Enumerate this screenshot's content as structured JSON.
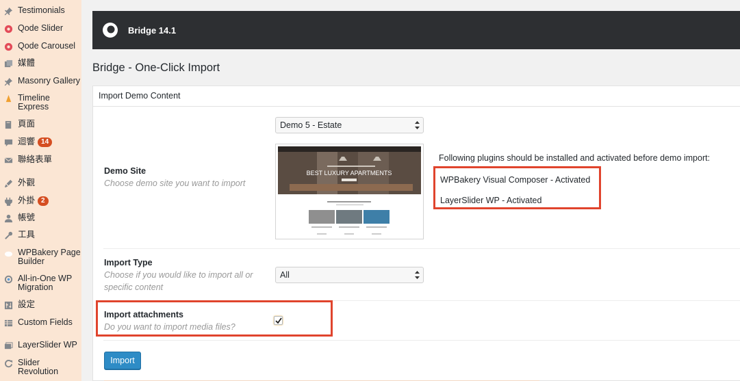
{
  "sidebar": {
    "items": [
      {
        "label": "Testimonials",
        "icon": "pin-icon"
      },
      {
        "label": "Qode Slider",
        "icon": "qode-icon"
      },
      {
        "label": "Qode Carousel",
        "icon": "qode-icon"
      },
      {
        "label": "媒體",
        "icon": "media-icon"
      },
      {
        "label": "Masonry Gallery",
        "icon": "pin-icon"
      },
      {
        "label": "Timeline Express",
        "icon": "timeline-icon"
      },
      {
        "label": "頁面",
        "icon": "pages-icon"
      },
      {
        "label": "迴響",
        "icon": "comments-icon",
        "badge": "14"
      },
      {
        "label": "聯絡表單",
        "icon": "mail-icon"
      },
      {
        "label": "外觀",
        "icon": "appearance-icon"
      },
      {
        "label": "外掛",
        "icon": "plugins-icon",
        "badge": "2"
      },
      {
        "label": "帳號",
        "icon": "users-icon"
      },
      {
        "label": "工具",
        "icon": "tools-icon"
      },
      {
        "label": "WPBakery Page Builder",
        "icon": "wpbakery-icon"
      },
      {
        "label": "All-in-One WP Migration",
        "icon": "migration-icon"
      },
      {
        "label": "設定",
        "icon": "settings-icon"
      },
      {
        "label": "Custom Fields",
        "icon": "custom-fields-icon"
      },
      {
        "label": "LayerSlider WP",
        "icon": "layerslider-icon"
      },
      {
        "label": "Slider Revolution",
        "icon": "revolution-icon"
      }
    ]
  },
  "header": {
    "title": "Bridge 14.1"
  },
  "page": {
    "title": "Bridge - One-Click Import"
  },
  "panel": {
    "heading": "Import Demo Content",
    "demo_site": {
      "label": "Demo Site",
      "description": "Choose demo site you want to import",
      "selected": "Demo 5 - Estate",
      "preview": {
        "hero_text": "BEST LUXURY APARTMENTS"
      }
    },
    "plugins": {
      "intro": "Following plugins should be installed and activated before demo import:",
      "items": [
        "WPBakery Visual Composer - Activated",
        "LayerSlider WP - Activated"
      ]
    },
    "import_type": {
      "label": "Import Type",
      "description": "Choose if you would like to import all or specific content",
      "selected": "All"
    },
    "attachments": {
      "label": "Import attachments",
      "description": "Do you want to import media files?",
      "checked": true
    },
    "import_button": "Import"
  },
  "colors": {
    "sidebar_bg": "#fbe6d4",
    "header_bg": "#2d2f32",
    "highlight_border": "#e0442d",
    "button_bg": "#2e8cc6",
    "badge_bg": "#d54e21"
  }
}
